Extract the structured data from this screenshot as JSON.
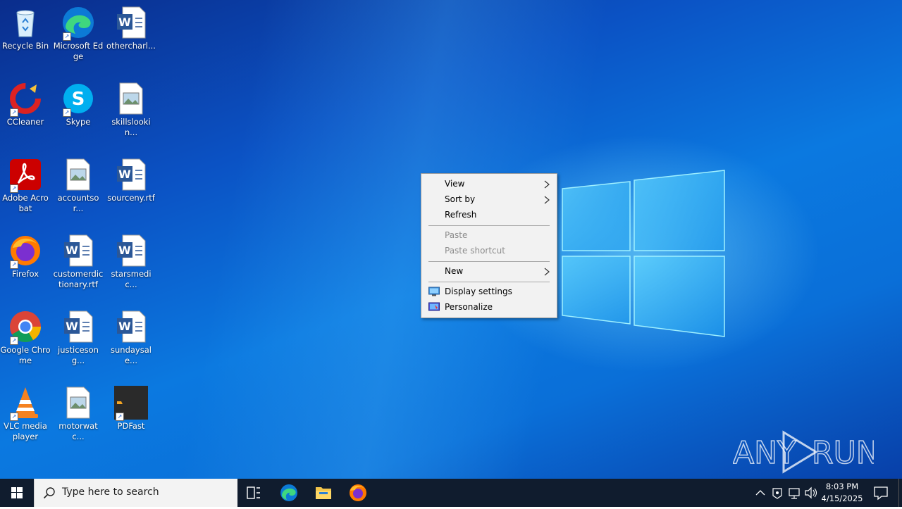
{
  "desktop": {
    "icons": [
      {
        "label": "Recycle Bin"
      },
      {
        "label": "Microsoft Edge"
      },
      {
        "label": "othercharl..."
      },
      {
        "label": "CCleaner"
      },
      {
        "label": "Skype"
      },
      {
        "label": "skillslookin..."
      },
      {
        "label": "Adobe Acrobat"
      },
      {
        "label": "accountsor..."
      },
      {
        "label": "sourceny.rtf"
      },
      {
        "label": "Firefox"
      },
      {
        "label": "customerdictionary.rtf"
      },
      {
        "label": "starsmedic..."
      },
      {
        "label": "Google Chrome"
      },
      {
        "label": "justicesong..."
      },
      {
        "label": "sundaysale..."
      },
      {
        "label": "VLC media player"
      },
      {
        "label": "motorwatc..."
      },
      {
        "label": "PDFast"
      }
    ],
    "watermark": "ANY RUN"
  },
  "context_menu": {
    "view": "View",
    "sort_by": "Sort by",
    "refresh": "Refresh",
    "paste": "Paste",
    "paste_shortcut": "Paste shortcut",
    "new": "New",
    "display_settings": "Display settings",
    "personalize": "Personalize"
  },
  "taskbar": {
    "search_placeholder": "Type here to search",
    "time": "8:03 PM",
    "date": "4/15/2025"
  },
  "colors": {
    "taskbar_bg": "#101c2e",
    "menu_bg": "#f2f2f2",
    "desktop_accent": "#0b79e0"
  }
}
